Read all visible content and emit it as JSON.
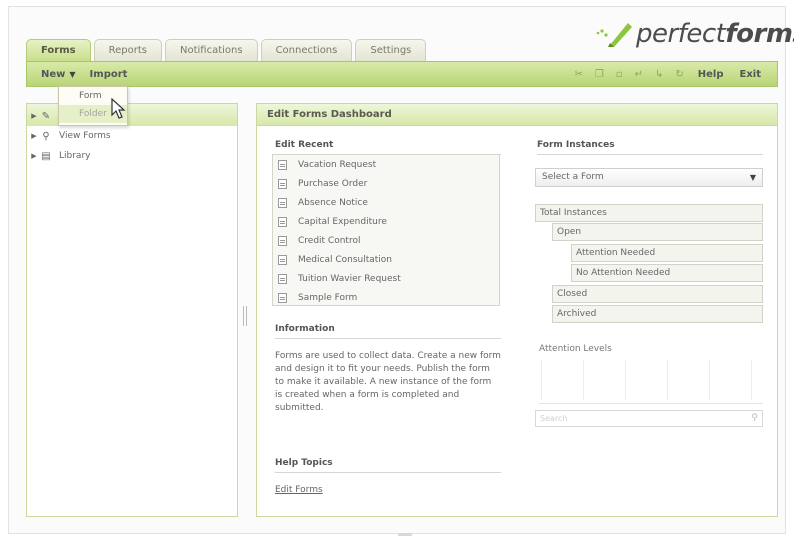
{
  "logo": {
    "brand_light": "perfect",
    "brand_bold": "forms"
  },
  "tabs": [
    {
      "label": "Forms",
      "active": true
    },
    {
      "label": "Reports",
      "active": false
    },
    {
      "label": "Notifications",
      "active": false
    },
    {
      "label": "Connections",
      "active": false
    },
    {
      "label": "Settings",
      "active": false
    }
  ],
  "toolbar": {
    "new_label": "New",
    "dropdown_arrow": "▼",
    "import_label": "Import",
    "help_label": "Help",
    "exit_label": "Exit",
    "icons": [
      "cut-icon",
      "copy-icon",
      "paste-icon",
      "undo-icon",
      "redo-icon",
      "refresh-icon"
    ]
  },
  "new_menu": {
    "items": [
      "Form",
      "Folder"
    ]
  },
  "tree": {
    "items": [
      {
        "label": "",
        "icon": "pencil-icon"
      },
      {
        "label": "View Forms",
        "icon": "magnifier-icon"
      },
      {
        "label": "Library",
        "icon": "book-icon"
      }
    ]
  },
  "dashboard": {
    "title": "Edit Forms Dashboard",
    "edit_recent": {
      "title": "Edit Recent",
      "items": [
        "Vacation Request",
        "Purchase Order",
        "Absence Notice",
        "Capital Expenditure",
        "Credit Control",
        "Medical Consultation",
        "Tuition Wavier Request",
        "Sample Form"
      ]
    },
    "information": {
      "title": "Information",
      "text": "Forms are used to collect data. Create a new form and design it to fit your needs. Publish the form to make it available. A new instance of the form is created when a form is completed and submitted."
    },
    "help_topics": {
      "title": "Help Topics",
      "link": "Edit Forms"
    },
    "form_instances": {
      "title": "Form Instances",
      "select_placeholder": "Select a Form",
      "select_arrow": "▼",
      "total": "Total Instances",
      "open": "Open",
      "attention_needed": "Attention Needed",
      "no_attention_needed": "No Attention Needed",
      "closed": "Closed",
      "archived": "Archived"
    },
    "attention_levels": {
      "title": "Attention Levels",
      "search_placeholder": "Search"
    }
  },
  "colors": {
    "accent_green": "#b8d577",
    "header_green": "#d6e8a8",
    "border_green": "#c9d9a0",
    "logo_green": "#8cc63f"
  }
}
